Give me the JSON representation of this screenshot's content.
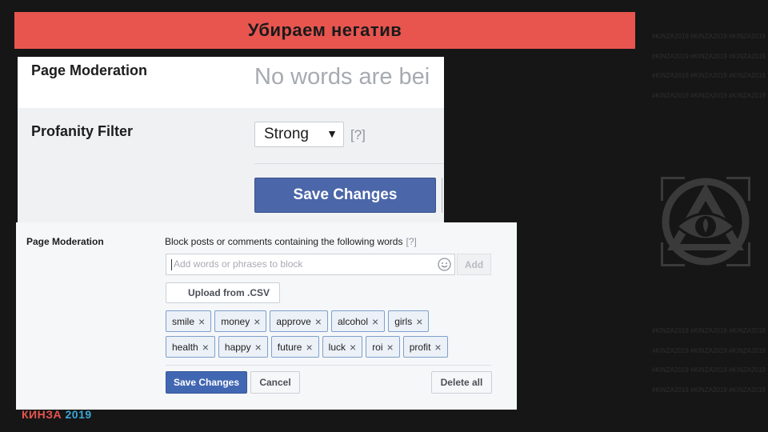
{
  "slide": {
    "title": "Убираем негатив",
    "hashtag_line": "#KINZA2019 #KINZA2019 #KINZA2019",
    "brand_kinza": "КИНЗА",
    "brand_year": "2019",
    "accent_color": "#e8554f",
    "logo_icon": "all-seeing-eye-triangle-icon"
  },
  "zoomed_panel": {
    "page_moderation_label": "Page Moderation",
    "no_words_text": "No words are bei",
    "profanity_filter_label": "Profanity Filter",
    "profanity_filter_value": "Strong",
    "help_text": "[?]",
    "save_label": "Save Changes"
  },
  "moderation_panel": {
    "label": "Page Moderation",
    "description": "Block posts or comments containing the following words",
    "help_text": "[?]",
    "input_placeholder": "Add words or phrases to block",
    "add_label": "Add",
    "upload_label": "Upload from .CSV",
    "chips_row1": [
      "smile",
      "money",
      "approve",
      "alcohol",
      "girls"
    ],
    "chips_row2": [
      "health",
      "happy",
      "future",
      "luck",
      "roi",
      "profit"
    ],
    "remove_icon": "×",
    "save_label": "Save Changes",
    "cancel_label": "Cancel",
    "delete_all_label": "Delete all"
  }
}
